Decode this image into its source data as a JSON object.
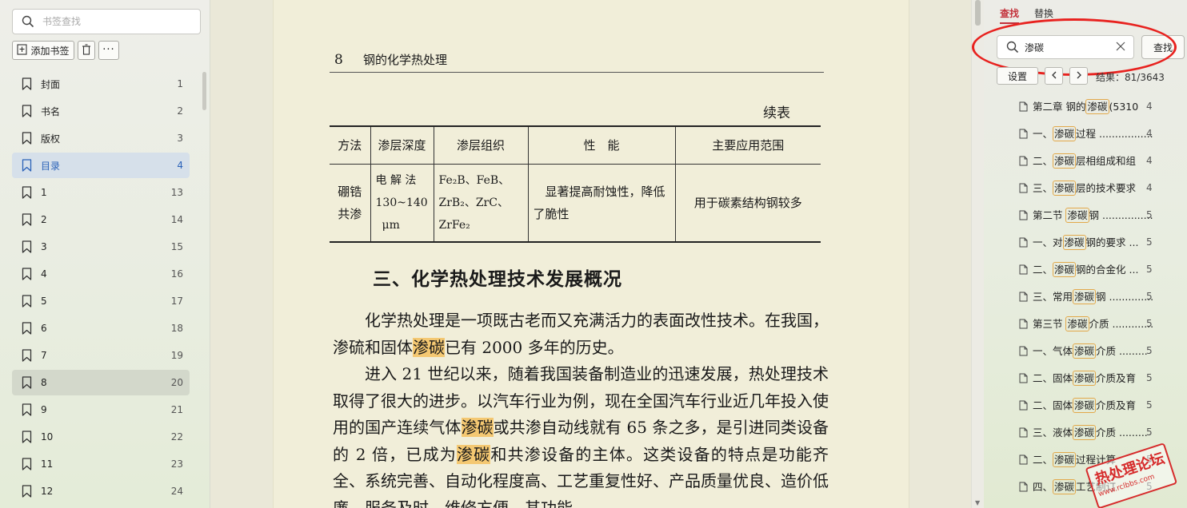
{
  "sidebar": {
    "search_placeholder": "书签查找",
    "add_bookmark_label": "添加书签",
    "items": [
      {
        "label": "封面",
        "page": "1"
      },
      {
        "label": "书名",
        "page": "2"
      },
      {
        "label": "版权",
        "page": "3"
      },
      {
        "label": "目录",
        "page": "4"
      },
      {
        "label": "1",
        "page": "13"
      },
      {
        "label": "2",
        "page": "14"
      },
      {
        "label": "3",
        "page": "15"
      },
      {
        "label": "4",
        "page": "16"
      },
      {
        "label": "5",
        "page": "17"
      },
      {
        "label": "6",
        "page": "18"
      },
      {
        "label": "7",
        "page": "19"
      },
      {
        "label": "8",
        "page": "20"
      },
      {
        "label": "9",
        "page": "21"
      },
      {
        "label": "10",
        "page": "22"
      },
      {
        "label": "11",
        "page": "23"
      },
      {
        "label": "12",
        "page": "24"
      }
    ],
    "selected_index": 3,
    "hover_index": 11
  },
  "document": {
    "page_number": "8",
    "header_title": "钢的化学热处理",
    "continued_label": "续表",
    "table": {
      "headers": [
        "方法",
        "渗层深度",
        "渗层组织",
        "性　能",
        "主要应用范围"
      ],
      "row": {
        "method": "硼锆共渗",
        "depth_line1": "电 解 法",
        "depth_line2": "130~140",
        "depth_line3": "μm",
        "structure_line1": "Fe₂B、FeB、",
        "structure_line2": "ZrB₂、ZrC、",
        "structure_line3": "ZrFe₂",
        "properties": "显著提高耐蚀性，降低了脆性",
        "application": "用于碳素结构钢较多"
      }
    },
    "section_heading": "三、化学热处理技术发展概况",
    "para1_a": "化学热处理是一项既古老而又充满活力的表面改性技术。在我国，渗硫和固体",
    "para1_hl": "渗碳",
    "para1_b": "已有 2000 多年的历史。",
    "para2_a": "进入 21 世纪以来，随着我国装备制造业的迅速发展，热处理技术取得了很大的进步。以汽车行业为例，现在全国汽车行业近几年投入使用的国产连续气体",
    "para2_hl1": "渗碳",
    "para2_b": "或共渗自动线就有 65 条之多，是引进同类设备的 2 倍，已成为",
    "para2_hl2": "渗碳",
    "para2_c": "和共渗设备的主体。这类设备的特点是功能齐全、系统完善、自动化程度高、工艺重复性好、产品质量优良、造价低廉、服务及时、维修方便，其功能"
  },
  "find_panel": {
    "tab_find": "查找",
    "tab_replace": "替换",
    "search_value": "渗碳",
    "find_button": "查找",
    "settings_button": "设置",
    "result_count": "结果：81/3643",
    "results": [
      {
        "pre": "第二章 钢的",
        "hl": "渗碳",
        "post": "(5310",
        "page": "4"
      },
      {
        "pre": "一、",
        "hl": "渗碳",
        "post": "过程 ..................",
        "page": "4"
      },
      {
        "pre": "二、",
        "hl": "渗碳",
        "post": "层相组成和组",
        "page": "4"
      },
      {
        "pre": "三、",
        "hl": "渗碳",
        "post": "层的技术要求",
        "page": "4"
      },
      {
        "pre": "第二节 ",
        "hl": "渗碳",
        "post": "钢 ..................",
        "page": "5"
      },
      {
        "pre": "一、对",
        "hl": "渗碳",
        "post": "钢的要求 ...",
        "page": "5"
      },
      {
        "pre": "二、",
        "hl": "渗碳",
        "post": "钢的合金化 ...",
        "page": "5"
      },
      {
        "pre": "三、常用",
        "hl": "渗碳",
        "post": "钢 ..............",
        "page": "5"
      },
      {
        "pre": "第三节 ",
        "hl": "渗碳",
        "post": "介质 ..............",
        "page": "5"
      },
      {
        "pre": "一、气体",
        "hl": "渗碳",
        "post": "介质 .........",
        "page": "5"
      },
      {
        "pre": "二、固体",
        "hl": "渗碳",
        "post": "介质及育",
        "page": "5"
      },
      {
        "pre": "二、固体",
        "hl": "渗碳",
        "post": "介质及育",
        "page": "5"
      },
      {
        "pre": "三、液体",
        "hl": "渗碳",
        "post": "介质 .........",
        "page": "5"
      },
      {
        "pre": "二、",
        "hl": "渗碳",
        "post": "过程计算",
        "page": "5"
      },
      {
        "pre": "四、",
        "hl": "渗碳",
        "post": "工艺制订",
        "page": "5"
      }
    ]
  },
  "watermark": {
    "title": "热处理论坛",
    "url": "www.rclbbs.com"
  },
  "colors": {
    "accent_red": "#c3313a",
    "selected_blue": "#2a62b8",
    "highlight": "#f4c872",
    "annotation_red": "#e8221f"
  }
}
